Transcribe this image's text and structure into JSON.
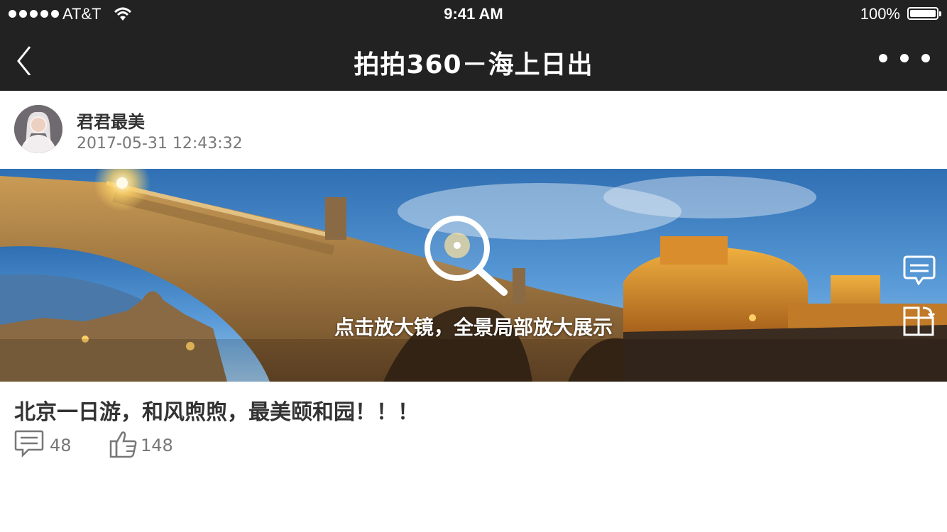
{
  "status_bar": {
    "carrier": "AT&T",
    "time": "9:41 AM",
    "battery": "100%"
  },
  "nav": {
    "title": "拍拍360－海上日出",
    "back_icon": "chevron-left-icon",
    "more_icon": "more-dots-icon"
  },
  "author": {
    "name": "君君最美",
    "timestamp": "2017-05-31   12:43:32"
  },
  "panorama": {
    "hint": "点击放大镜，全景局部放大展示",
    "icons": [
      "magnifier-icon",
      "comment-bubble-icon",
      "rotate-view-icon"
    ]
  },
  "post": {
    "title": "北京一日游，和风煦煦，最美颐和园！！！",
    "comment_count": "48",
    "like_count": "148"
  },
  "colors": {
    "bar_bg": "#222222",
    "text_dark": "#333333",
    "text_gray": "#777777"
  }
}
